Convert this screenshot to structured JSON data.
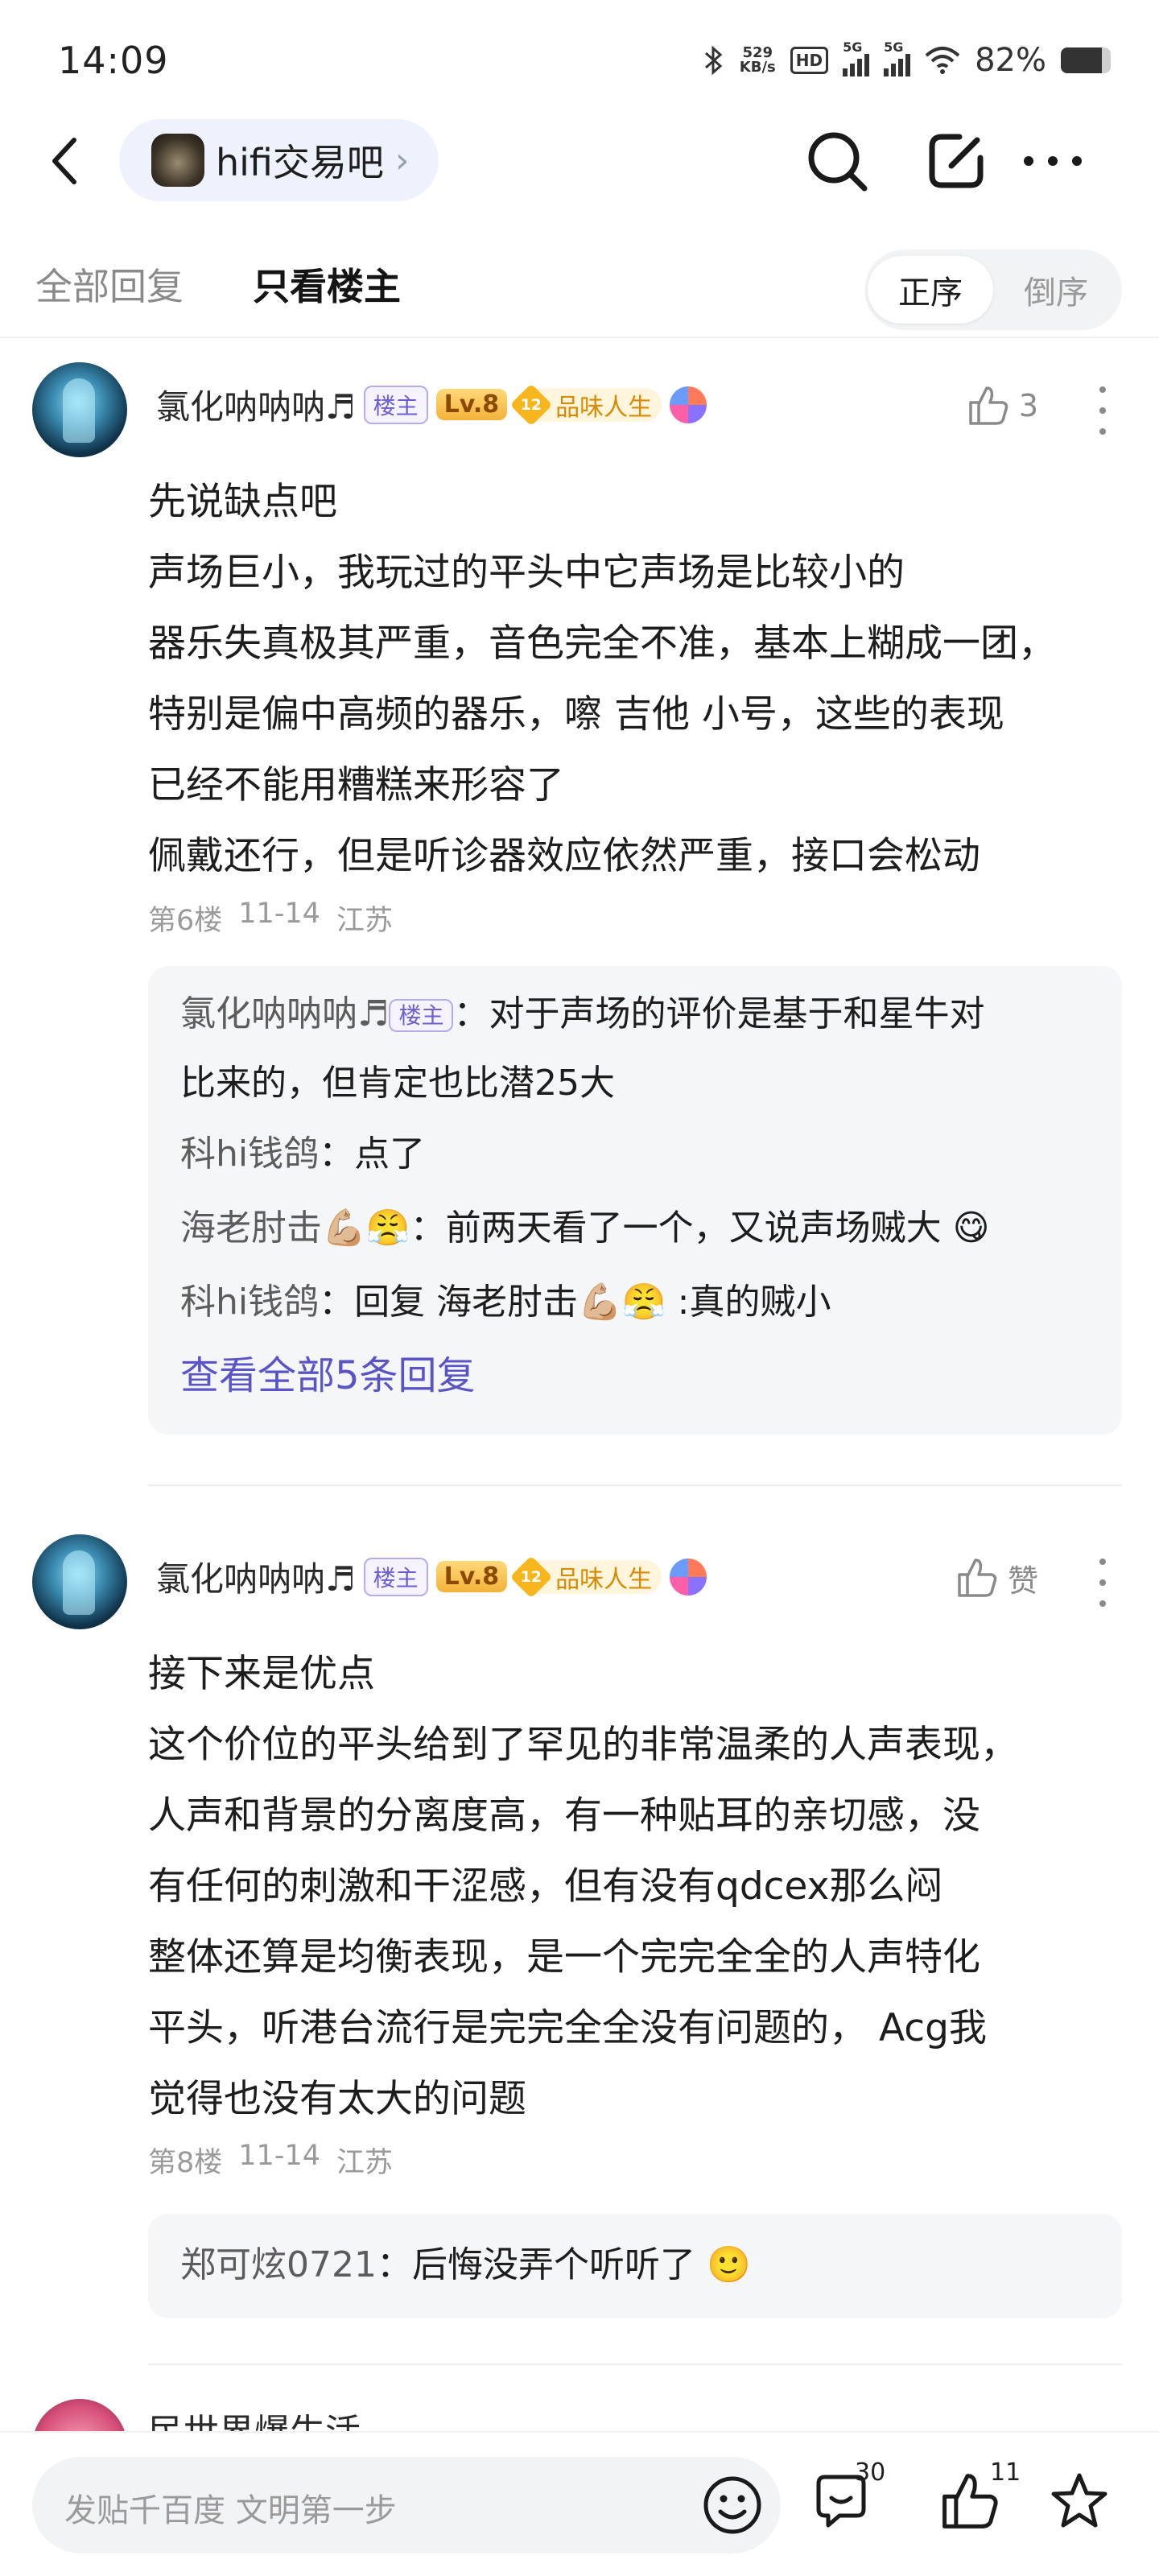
{
  "status_bar": {
    "time": "14:09",
    "net_speed": "529",
    "net_unit": "KB/s",
    "hd_label": "HD",
    "sim1_label": "5G",
    "sim2_label": "5G",
    "battery": "82%",
    "battery_level": 0.82
  },
  "nav": {
    "forum_name": "hifi交易吧",
    "forum_chevron": "›"
  },
  "tabs": {
    "all_replies": "全部回复",
    "op_only": "只看楼主",
    "sort_asc": "正序",
    "sort_desc": "倒序"
  },
  "posts": [
    {
      "username": "氯化呐呐呐♬",
      "op_badge": "楼主",
      "level": "Lv.8",
      "honor_level": "12",
      "honor_title": "品味人生",
      "like_count": "3",
      "lines": [
        "先说缺点吧",
        "声场巨小，我玩过的平头中它声场是比较小的",
        "器乐失真极其严重，音色完全不准，基本上糊成一团，",
        "特别是偏中高频的器乐，嚓 吉他 小号，这些的表现",
        "已经不能用糟糕来形容了",
        "佩戴还行，但是听诊器效应依然严重，接口会松动"
      ],
      "floor": "第6楼",
      "date": "11-14",
      "location": "江苏",
      "replies": [
        {
          "name": "氯化呐呐呐♬",
          "badge": "楼主",
          "text_1": "：对于声场的评价是基于和星牛对",
          "text_2": "比来的，但肯定也比潜25大"
        },
        {
          "name": "科hi钱鸽",
          "text": "：点了"
        },
        {
          "name": "海老肘击💪🏼😤",
          "text": "：前两天看了一个，又说声场贼大 😋"
        },
        {
          "name": "科hi钱鸽",
          "text": "：回复 海老肘击💪🏼😤 :真的贼小"
        }
      ],
      "view_all": "查看全部5条回复"
    },
    {
      "username": "氯化呐呐呐♬",
      "op_badge": "楼主",
      "level": "Lv.8",
      "honor_level": "12",
      "honor_title": "品味人生",
      "like_label": "赞",
      "lines": [
        "接下来是优点",
        "这个价位的平头给到了罕见的非常温柔的人声表现，",
        "人声和背景的分离度高，有一种贴耳的亲切感，没",
        "有任何的刺激和干涩感，但有没有qdcex那么闷",
        "整体还算是均衡表现，是一个完完全全的人声特化",
        "平头，听港台流行是完完全全没有问题的， Acg我",
        "觉得也没有太大的问题"
      ],
      "floor": "第8楼",
      "date": "11-14",
      "location": "江苏",
      "replies": [
        {
          "name": "郑可炫0721",
          "text": "：后悔没弄个听听了 🙂"
        }
      ]
    }
  ],
  "peek_post": {
    "username": "民世界爆生活"
  },
  "bottom_bar": {
    "compose_placeholder": "发贴千百度 文明第一步",
    "comment_count": "30",
    "like_count": "11"
  }
}
